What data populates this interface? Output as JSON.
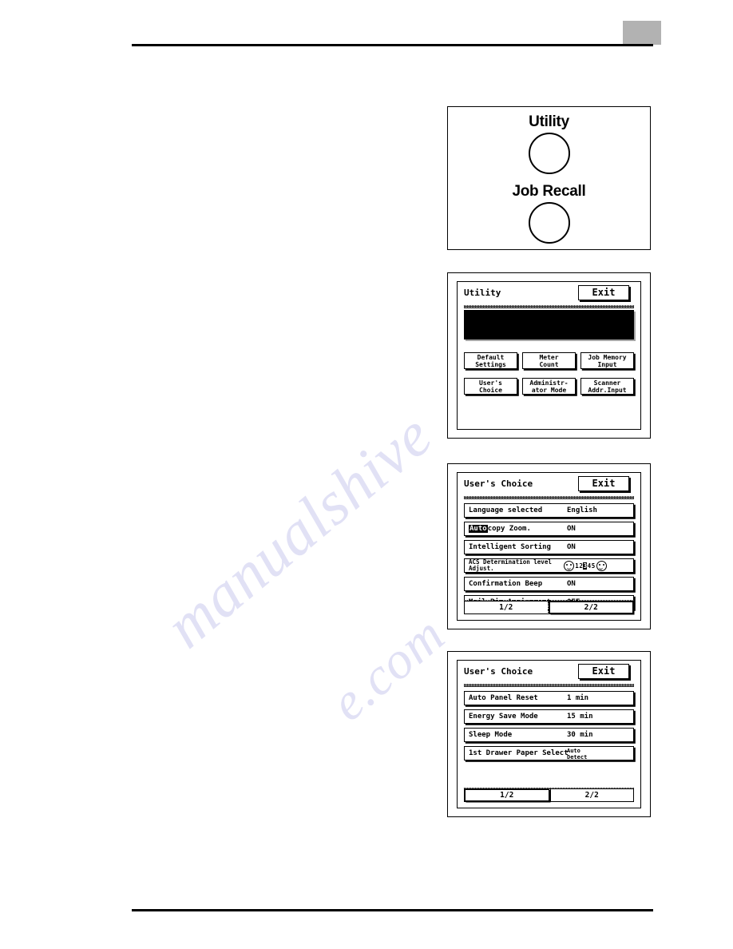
{
  "page": {
    "tab_marker_color": "#b2b2b2",
    "watermark_line1": "manualshive",
    "watermark_line2": "e.com"
  },
  "fig_keys": {
    "utility_label": "Utility",
    "job_recall_label": "Job Recall"
  },
  "fig_utility": {
    "title": "Utility",
    "exit_label": "Exit",
    "buttons": [
      {
        "line1": "Default",
        "line2": "Settings"
      },
      {
        "line1": "Meter",
        "line2": "Count"
      },
      {
        "line1": "Job Memory",
        "line2": "Input"
      },
      {
        "line1": "User's",
        "line2": "Choice"
      },
      {
        "line1": "Administr-",
        "line2": "ator Mode"
      },
      {
        "line1": "Scanner",
        "line2": "Addr.Input"
      }
    ]
  },
  "fig_uc_page2": {
    "title": "User's Choice",
    "exit_label": "Exit",
    "rows": [
      {
        "label": "Language selected",
        "value": "English"
      },
      {
        "label_prefix": "Auto",
        "label_rest": "copy Zoom.",
        "value": "ON"
      },
      {
        "label": "Intelligent Sorting",
        "value": "ON"
      },
      {
        "label_line1": "ACS Determination level",
        "label_line2": "Adjust.",
        "scale": {
          "numbers": [
            "1",
            "2",
            "3",
            "4",
            "5"
          ],
          "selected": "3",
          "left_icon": "face-icon",
          "right_icon": "face-icon"
        }
      },
      {
        "label": "Confirmation Beep",
        "value": "ON"
      },
      {
        "label": "Mail Bin Assignment",
        "value": "OFF"
      }
    ],
    "pager": {
      "tabs": [
        "1/2",
        "2/2"
      ],
      "active": "2/2"
    }
  },
  "fig_uc_page1": {
    "title": "User's Choice",
    "exit_label": "Exit",
    "rows": [
      {
        "label": "Auto Panel Reset",
        "value": "1 min"
      },
      {
        "label": "Energy Save Mode",
        "value": "15 min"
      },
      {
        "label": "Sleep Mode",
        "value": "30 min"
      },
      {
        "label": "1st Drawer Paper Select",
        "value_line1": "Auto",
        "value_line2": "Detect"
      }
    ],
    "pager": {
      "tabs": [
        "1/2",
        "2/2"
      ],
      "active": "1/2"
    }
  }
}
